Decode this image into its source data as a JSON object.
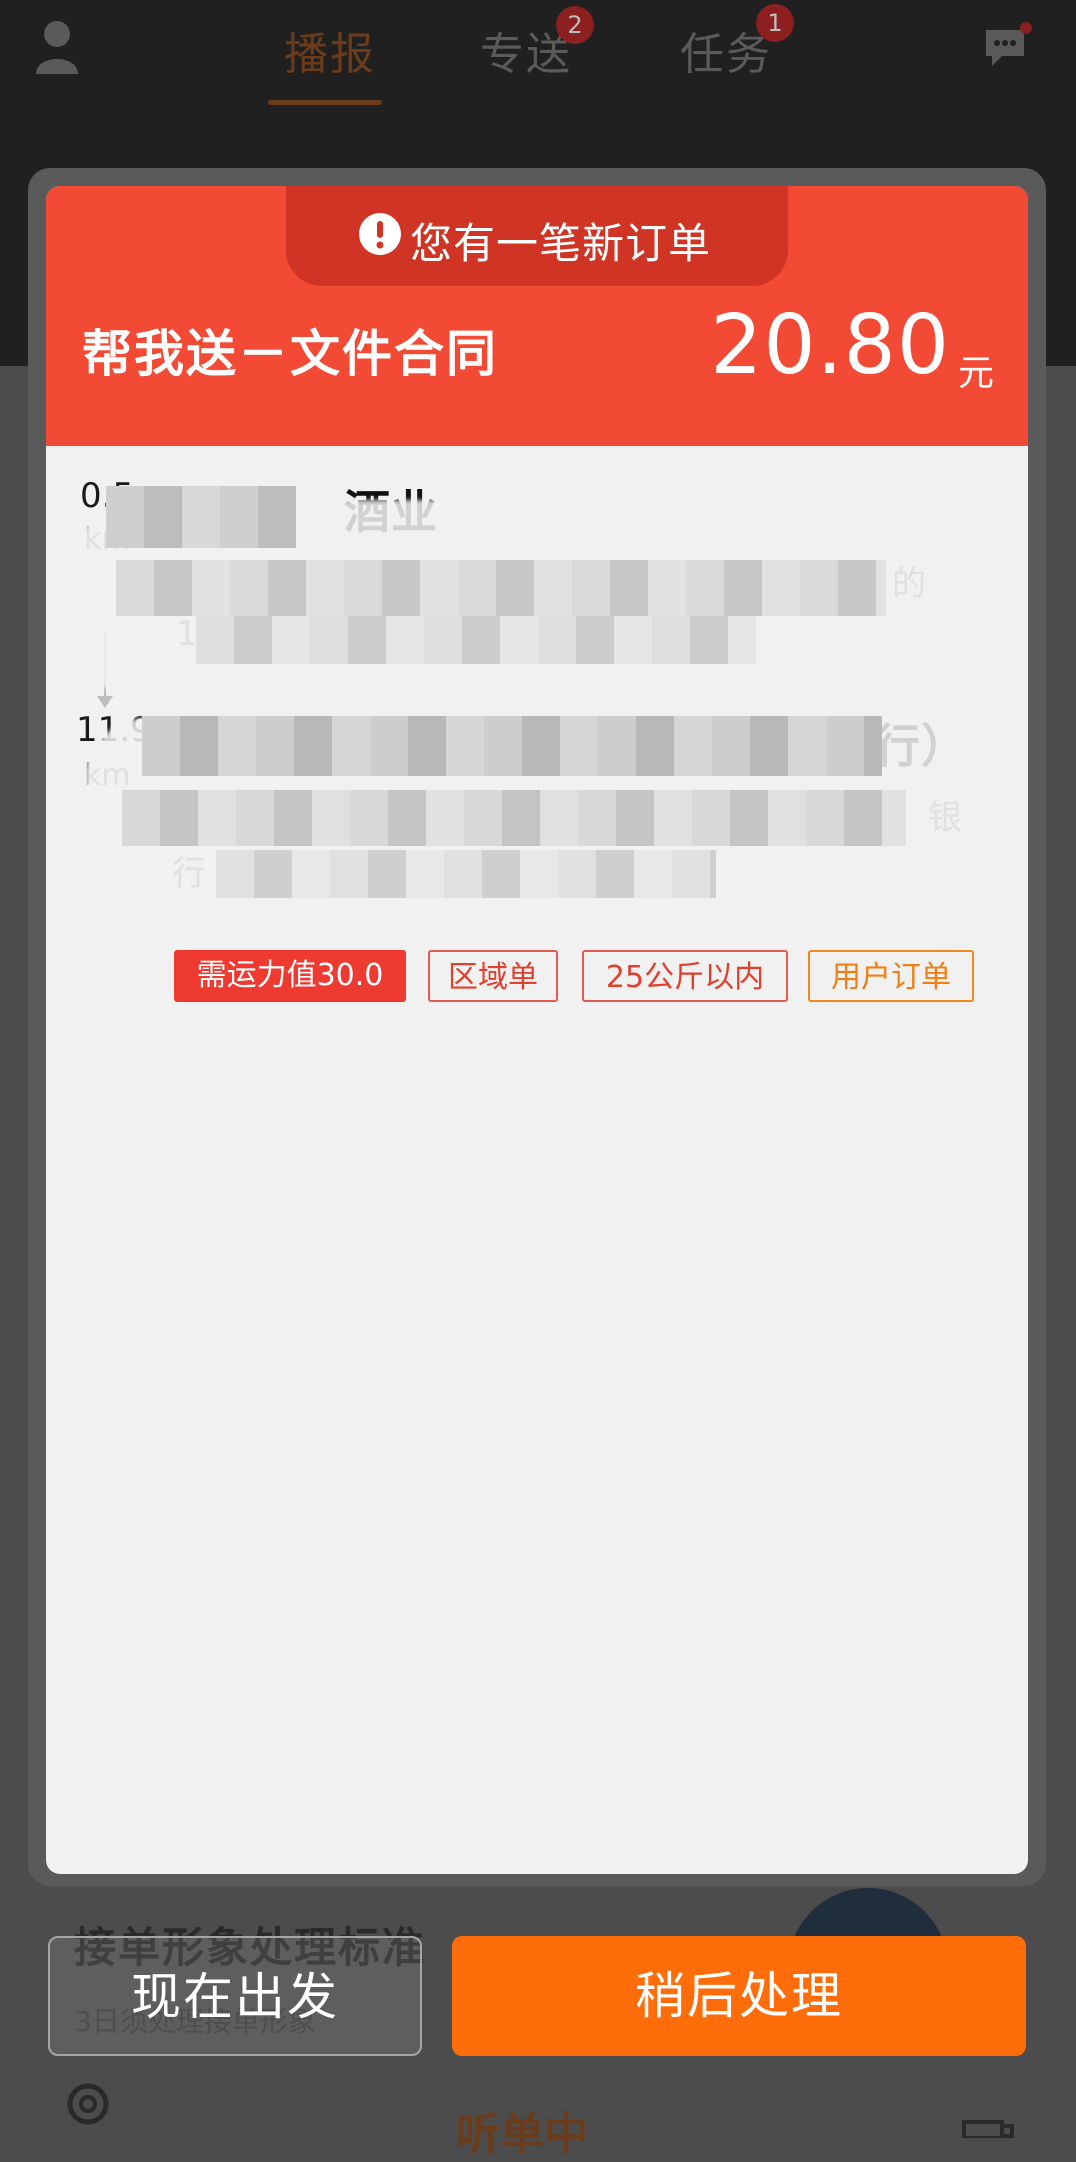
{
  "topbar": {
    "tabs": [
      {
        "label": "播报",
        "badge": ""
      },
      {
        "label": "专送",
        "badge": "2"
      },
      {
        "label": "任务",
        "badge": "1"
      }
    ]
  },
  "background": {
    "title": "接单形象处理标准",
    "subtitle": "3日须处理接单形象",
    "bottom_nav_center": "听单中"
  },
  "modal": {
    "notice": "您有一笔新订单",
    "order_title": "帮我送－文件合同",
    "price": "20.80",
    "price_unit": "元",
    "stops": [
      {
        "distance": "0.5",
        "unit": "km",
        "name": "酒业",
        "address_tail": "的",
        "address_line2": "10"
      },
      {
        "distance": "11.9",
        "unit": "km",
        "name": "行）",
        "address_tail": "银",
        "address_line2": "行"
      }
    ],
    "tags": [
      {
        "label": "需运力值30.0",
        "style": "filled"
      },
      {
        "label": "区域单",
        "style": "outline-red"
      },
      {
        "label": "25公斤以内",
        "style": "outline-red"
      },
      {
        "label": "用户订单",
        "style": "outline-orange"
      }
    ]
  },
  "buttons": {
    "now": "现在出发",
    "later": "稍后处理"
  },
  "colors": {
    "accent_red": "#f24a35",
    "accent_orange": "#ff6d0a"
  }
}
